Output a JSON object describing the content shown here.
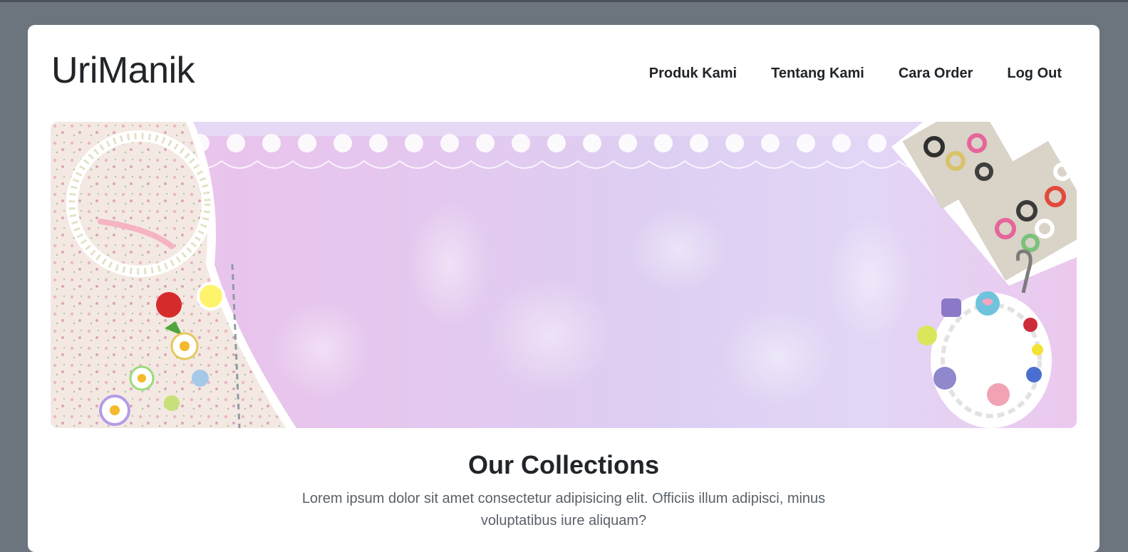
{
  "header": {
    "brand": "UriManik",
    "nav": [
      {
        "label": "Produk Kami"
      },
      {
        "label": "Tentang Kami"
      },
      {
        "label": "Cara Order"
      },
      {
        "label": "Log Out"
      }
    ]
  },
  "hero": {
    "title": "Our Collections",
    "description": "Lorem ipsum dolor sit amet consectetur adipisicing elit. Officiis illum adipisci, minus voluptatibus iure aliquam?"
  },
  "colors": {
    "backdrop": "#6c757d",
    "card": "#ffffff",
    "text": "#212529",
    "banner_pink": "#ecc2ea",
    "banner_lavender": "#ddcff2"
  }
}
